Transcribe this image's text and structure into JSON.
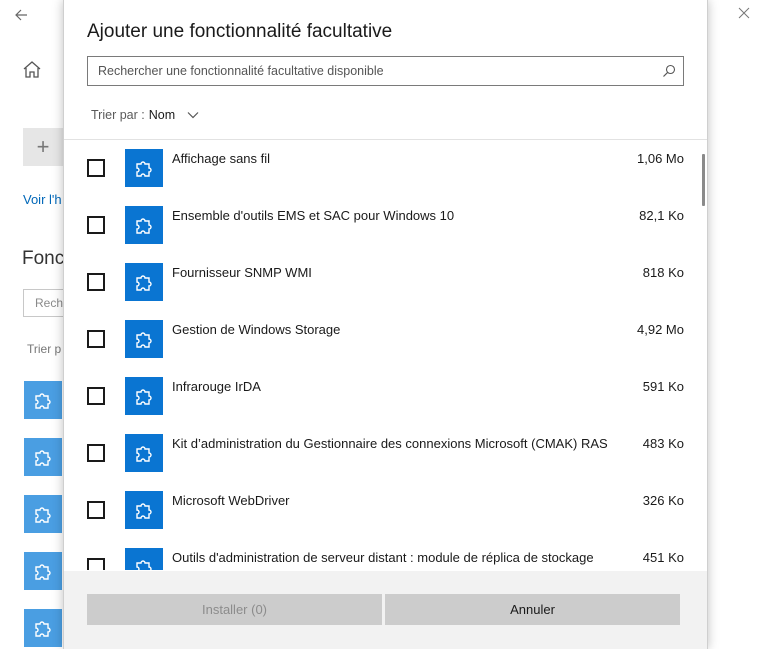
{
  "background": {
    "link_partial": "Voir l'h",
    "heading_partial": "Fonc",
    "search_partial": "Rech",
    "sort_partial": "Trier p",
    "add_symbol": "+"
  },
  "dialog": {
    "title": "Ajouter une fonctionnalité facultative",
    "search": {
      "placeholder": "Rechercher une fonctionnalité facultative disponible"
    },
    "sort": {
      "label": "Trier par :",
      "value": "Nom"
    },
    "items": [
      {
        "name": "Affichage sans fil",
        "size": "1,06 Mo",
        "checked": false
      },
      {
        "name": "Ensemble d'outils EMS et SAC pour Windows 10",
        "size": "82,1 Ko",
        "checked": false
      },
      {
        "name": "Fournisseur SNMP WMI",
        "size": "818 Ko",
        "checked": false
      },
      {
        "name": "Gestion de Windows Storage",
        "size": "4,92 Mo",
        "checked": false
      },
      {
        "name": "Infrarouge IrDA",
        "size": "591 Ko",
        "checked": false
      },
      {
        "name": "Kit d’administration du Gestionnaire des connexions Microsoft (CMAK) RAS",
        "size": "483 Ko",
        "checked": false
      },
      {
        "name": "Microsoft WebDriver",
        "size": "326 Ko",
        "checked": false
      },
      {
        "name": "Outils d'administration de serveur distant : module de réplica de stockage",
        "size": "451 Ko",
        "checked": false
      }
    ],
    "buttons": {
      "install": "Installer (0)",
      "cancel": "Annuler"
    }
  },
  "colors": {
    "accent": "#0a75d2",
    "accent_light": "#4a9ee2"
  },
  "icons": [
    "back-arrow-icon",
    "home-icon",
    "puzzle-piece-icon",
    "search-icon",
    "chevron-down-icon",
    "minimize-icon",
    "maximize-icon",
    "close-icon"
  ]
}
